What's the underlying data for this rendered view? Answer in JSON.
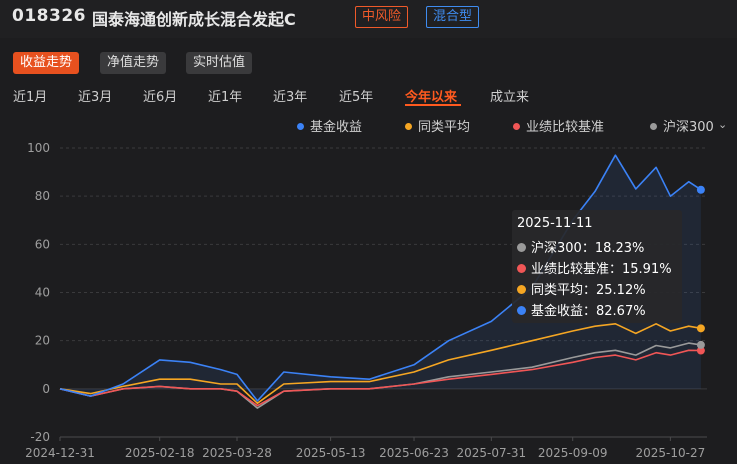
{
  "header": {
    "code": "018326",
    "name": "国泰海通创新成长混合发起C",
    "risk_badge": "中风险",
    "type_badge": "混合型"
  },
  "view_tabs": [
    {
      "label": "收益走势",
      "active": true
    },
    {
      "label": "净值走势",
      "active": false
    },
    {
      "label": "实时估值",
      "active": false
    }
  ],
  "period_tabs": [
    {
      "label": "近1月",
      "active": false
    },
    {
      "label": "近3月",
      "active": false
    },
    {
      "label": "近6月",
      "active": false
    },
    {
      "label": "近1年",
      "active": false
    },
    {
      "label": "近3年",
      "active": false
    },
    {
      "label": "近5年",
      "active": false
    },
    {
      "label": "今年以来",
      "active": true
    },
    {
      "label": "成立来",
      "active": false
    }
  ],
  "legend": [
    {
      "label": "基金收益",
      "color": "#3b82f6"
    },
    {
      "label": "同类平均",
      "color": "#f5a623"
    },
    {
      "label": "业绩比较基准",
      "color": "#f05656"
    },
    {
      "label": "沪深300",
      "color": "#9a9a9a"
    }
  ],
  "tooltip": {
    "date": "2025-11-11",
    "rows": [
      {
        "label": "沪深300：18.23%",
        "color": "#9a9a9a"
      },
      {
        "label": "业绩比较基准：15.91%",
        "color": "#f05656"
      },
      {
        "label": "同类平均：25.12%",
        "color": "#f5a623"
      },
      {
        "label": "基金收益：82.67%",
        "color": "#3b82f6"
      }
    ]
  },
  "chart_data": {
    "type": "line",
    "y_ticks": [
      "100",
      "80",
      "60",
      "40",
      "20",
      "0",
      "-20"
    ],
    "ylim": [
      -20,
      100
    ],
    "x_ticks": [
      "2024-12-31",
      "2025-02-18",
      "2025-03-28",
      "2025-05-13",
      "2025-06-23",
      "2025-07-31",
      "2025-09-09",
      "2025-10-27"
    ],
    "x": [
      "2024-12-31",
      "2025-01-15",
      "2025-01-31",
      "2025-02-18",
      "2025-03-05",
      "2025-03-20",
      "2025-03-28",
      "2025-04-07",
      "2025-04-20",
      "2025-05-13",
      "2025-06-01",
      "2025-06-23",
      "2025-07-10",
      "2025-07-31",
      "2025-08-20",
      "2025-09-09",
      "2025-09-20",
      "2025-09-30",
      "2025-10-10",
      "2025-10-20",
      "2025-10-27",
      "2025-11-05",
      "2025-11-11"
    ],
    "series": [
      {
        "name": "基金收益",
        "color": "#3b82f6",
        "values": [
          0,
          -3,
          2,
          12,
          11,
          8,
          6,
          -5,
          7,
          5,
          4,
          10,
          20,
          28,
          42,
          70,
          82,
          97,
          83,
          92,
          80,
          86,
          82.67
        ]
      },
      {
        "name": "同类平均",
        "color": "#f5a623",
        "values": [
          0,
          -2,
          1,
          4,
          4,
          2,
          2,
          -6,
          2,
          3,
          3,
          7,
          12,
          16,
          20,
          24,
          26,
          27,
          23,
          27,
          24,
          26,
          25.12
        ]
      },
      {
        "name": "业绩比较基准",
        "color": "#f05656",
        "values": [
          0,
          -3,
          0,
          1,
          0,
          0,
          -1,
          -7,
          -1,
          0,
          0,
          2,
          4,
          6,
          8,
          11,
          13,
          14,
          12,
          15,
          14,
          16,
          15.91
        ]
      },
      {
        "name": "沪深300",
        "color": "#9a9a9a",
        "values": [
          0,
          -3,
          0,
          1,
          0,
          0,
          -1,
          -8,
          -1,
          0,
          0,
          2,
          5,
          7,
          9,
          13,
          15,
          16,
          14,
          18,
          17,
          19,
          18.23
        ]
      }
    ]
  }
}
